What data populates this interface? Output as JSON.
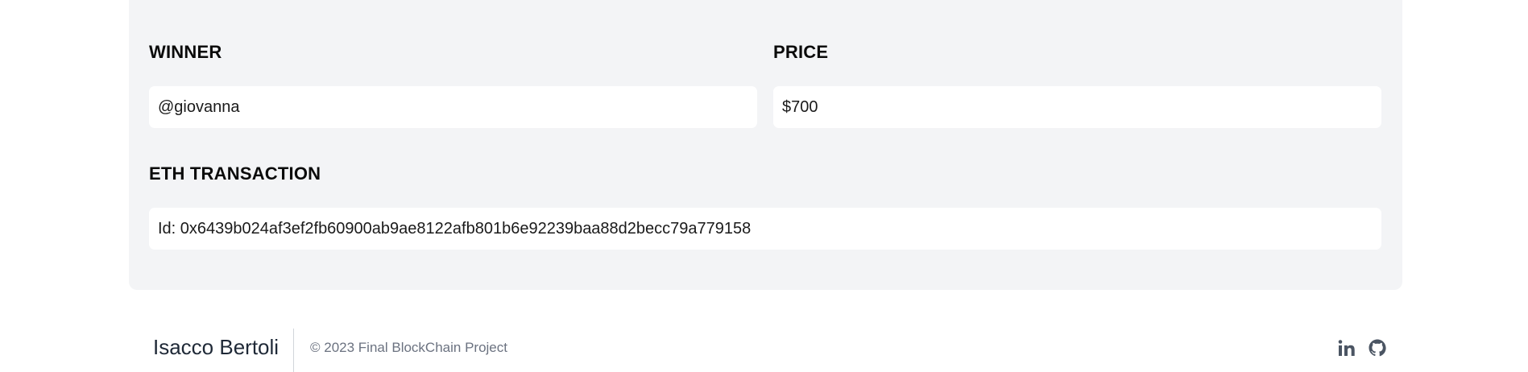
{
  "winner": {
    "label": "WINNER",
    "value": "@giovanna"
  },
  "price": {
    "label": "PRICE",
    "value": "$700"
  },
  "eth_transaction": {
    "label": "ETH TRANSACTION",
    "value": "Id: 0x6439b024af3ef2fb60900ab9ae8122afb801b6e92239baa88d2becc79a779158"
  },
  "footer": {
    "name": "Isacco Bertoli",
    "copyright": "© 2023 Final BlockChain Project",
    "social_icons": [
      "linkedin-icon",
      "github-icon"
    ]
  },
  "colors": {
    "card_background": "#f3f4f6",
    "field_background": "#ffffff",
    "footer_text": "#6b7280",
    "icon": "#4b5563"
  }
}
